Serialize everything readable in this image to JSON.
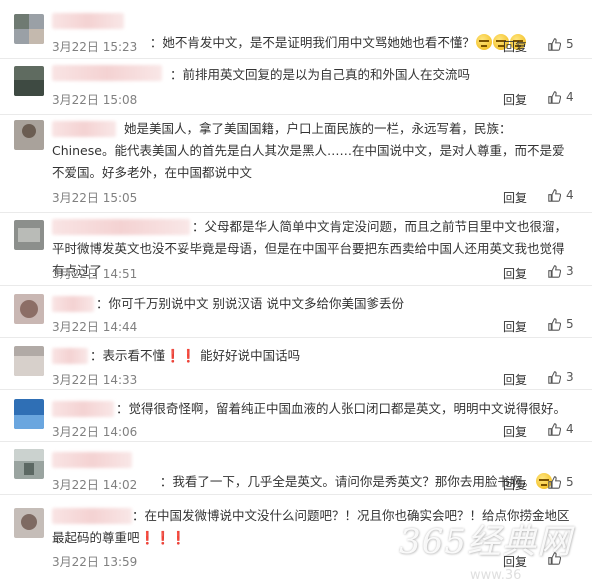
{
  "reply_label": "回复",
  "comments": [
    {
      "text": "：她不肯发中文，是不是证明我们用中文骂她她也看不懂？",
      "emojis": 3,
      "time": "3月22日 15:23",
      "likes": "5"
    },
    {
      "text": "：前排用英文回复的是以为自己真的和外国人在交流吗",
      "emojis": 0,
      "time": "3月22日 15:08",
      "likes": "4"
    },
    {
      "text": "她是美国人，拿了美国国籍，户口上面民族的一栏，永远写着，民族：Chinese。能代表美国人的首先是白人其次是黑人……在中国说中文，是对人尊重，而不是爱不爱国。好多老外，在中国都说中文",
      "emojis": 0,
      "time": "3月22日 15:05",
      "likes": "4"
    },
    {
      "text": "：父母都是华人简单中文肯定没问题，而且之前节目里中文也很溜，平时微博发英文也没不妥毕竟是母语，但是在中国平台要把东西卖给中国人还用英文我也觉得有点过了",
      "emojis": 0,
      "time": "3月22日 14:51",
      "likes": "3"
    },
    {
      "text": "：你可千万别说中文 别说汉语 说中文多给你美国爹丢份",
      "emojis": 0,
      "time": "3月22日 14:44",
      "likes": "5"
    },
    {
      "text": "：表示看不懂❗❗ 能好好说中国话吗",
      "emojis": 0,
      "time": "3月22日 14:33",
      "likes": "3"
    },
    {
      "text": "：觉得很奇怪啊，留着纯正中国血液的人张口闭口都是英文，明明中文说得很好。",
      "emojis": 0,
      "time": "3月22日 14:06",
      "likes": "4"
    },
    {
      "text": "：我看了一下，几乎全是英文。请问你是秀英文？那你去用脸书啊。",
      "emojis": 1,
      "time": "3月22日 14:02",
      "likes": "5"
    },
    {
      "text": "：在中国发微博说中文没什么问题吧？！况且你也确实会吧？！给点你捞金地区最起码的尊重吧❗❗❗",
      "emojis": 0,
      "time": "3月22日 13:59",
      "likes": ""
    }
  ],
  "watermark": "365经典网",
  "watermark_sub": "www.36"
}
